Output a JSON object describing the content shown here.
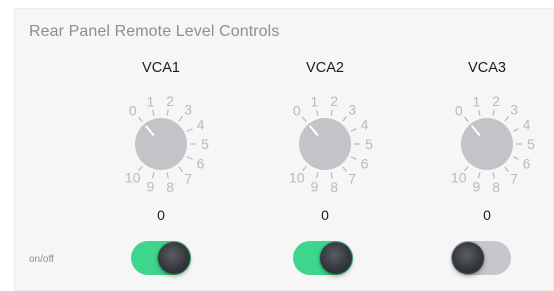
{
  "panel": {
    "title": "Rear Panel Remote Level Controls",
    "onoff_label": "on/off"
  },
  "channels": [
    {
      "label": "VCA1",
      "value": "0",
      "level": 0,
      "switch_on": true
    },
    {
      "label": "VCA2",
      "value": "0",
      "level": 0,
      "switch_on": true
    },
    {
      "label": "VCA3",
      "value": "0",
      "level": 0,
      "switch_on": false
    }
  ],
  "dial": {
    "scale": [
      "0",
      "1",
      "2",
      "3",
      "4",
      "5",
      "6",
      "7",
      "8",
      "9",
      "10"
    ]
  },
  "colors": {
    "switch_on": "#3dd68c",
    "switch_off": "#c6c7cb",
    "knob": "#c3c4c8",
    "scale": "#b9babe"
  }
}
